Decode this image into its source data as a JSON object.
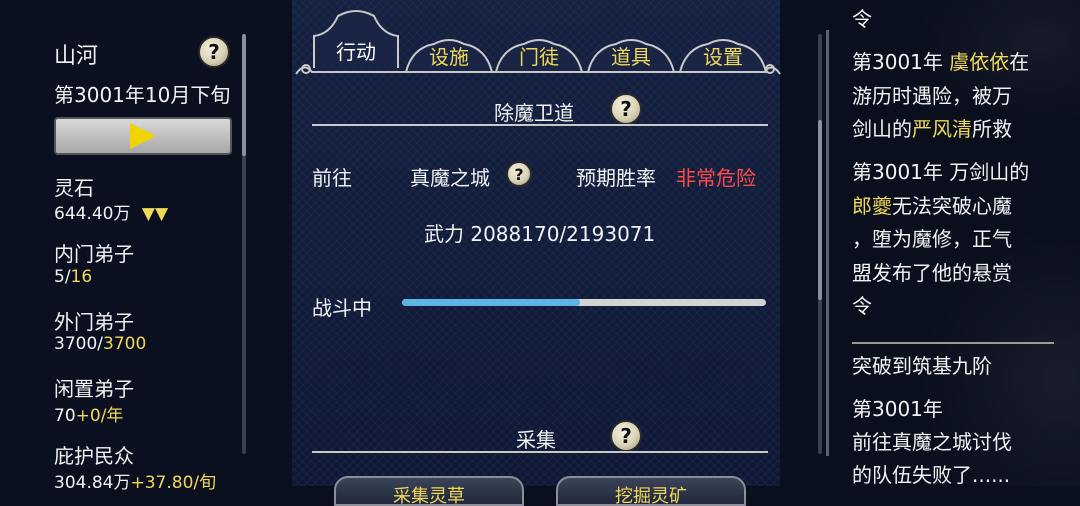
{
  "left": {
    "sect_name": "山河",
    "date": "第3001年10月下旬",
    "stats": [
      {
        "label": "灵石",
        "value": "644.40万",
        "extra": "▼▼"
      },
      {
        "label": "内门弟子",
        "value_a": "5/",
        "value_b": "16"
      },
      {
        "label": "外门弟子",
        "value_a": "3700/",
        "value_b": "3700"
      },
      {
        "label": "闲置弟子",
        "value_a": "70",
        "value_b": "+0/年"
      },
      {
        "label": "庇护民众",
        "value_a": "304.84万",
        "value_b": "+37.80/旬"
      }
    ],
    "help_glyph": "?"
  },
  "tabs": [
    {
      "label": "行动",
      "active": true
    },
    {
      "label": "设施",
      "active": false
    },
    {
      "label": "门徒",
      "active": false
    },
    {
      "label": "道具",
      "active": false
    },
    {
      "label": "设置",
      "active": false
    }
  ],
  "mission": {
    "title": "除魔卫道",
    "goto_label": "前往",
    "destination": "真魔之城",
    "win_rate_label": "预期胜率",
    "win_rate_value": "非常危险",
    "power": "武力 2088170/2193071",
    "status": "战斗中",
    "progress": 0.49
  },
  "gather": {
    "title": "采集",
    "btn1": "采集灵草",
    "btn2": "挖掘灵矿"
  },
  "log": {
    "line0": "令",
    "e1_year": "第3001年 ",
    "e1_name1": "虞依依",
    "e1_t1": "在",
    "e1_l2": "游历时遇险，被万",
    "e1_t2": "剑山的",
    "e1_name2": "严风清",
    "e1_t3": "所救",
    "e2_l1": "第3001年 万剑山的",
    "e2_name": "郎夔",
    "e2_t1": "无法突破心魔",
    "e2_l3": "，堕为魔修，正气",
    "e2_l4": "盟发布了他的悬赏",
    "e2_l5": "令",
    "e3_l1": "突破到筑基九阶",
    "e4_l1": "第3001年",
    "e4_l2": "前往真魔之城讨伐",
    "e4_l3": "的队伍失败了......"
  },
  "colors": {
    "highlight": "#f0d85a",
    "danger": "#ff4a4a",
    "progress": "#5bb4e4"
  }
}
